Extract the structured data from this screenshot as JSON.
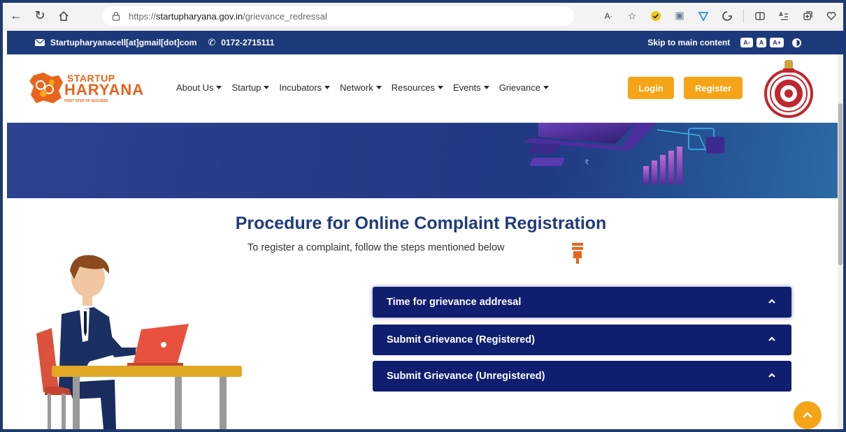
{
  "browser": {
    "url_prefix": "https://",
    "url_host": "startupharyana.gov.in",
    "url_path": "/grievance_redressal",
    "reader_label": "Ă"
  },
  "topbar": {
    "email": "Startupharyanacell[at]gmail[dot]com",
    "phone": "0172-2715111",
    "skip_link": "Skip to main content",
    "font_small": "A-",
    "font_normal": "A",
    "font_large": "A+"
  },
  "header": {
    "logo_line1": "STARTUP",
    "logo_line2": "HARYANA",
    "logo_tagline": "FIRST STEP OF SUCCESS",
    "nav": [
      "About Us",
      "Startup",
      "Incubators",
      "Network",
      "Resources",
      "Events",
      "Grievance"
    ],
    "login_label": "Login",
    "register_label": "Register"
  },
  "main": {
    "title": "Procedure for Online Complaint Registration",
    "subtitle": "To register a complaint, follow the steps mentioned below",
    "accordion": [
      {
        "label": "Time for grievance addresal"
      },
      {
        "label": "Submit Grievance (Registered)"
      },
      {
        "label": "Submit Grievance (Unregistered)"
      }
    ]
  },
  "colors": {
    "brand_orange": "#f5a417",
    "navy": "#1c3a7a",
    "accordion": "#0f1e6e",
    "title": "#1f3b7d"
  }
}
